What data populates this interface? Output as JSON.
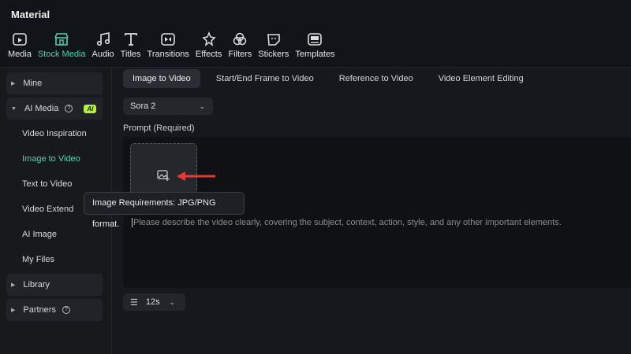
{
  "header": {
    "title": "Material"
  },
  "toolbar": [
    {
      "label": "Media",
      "icon": "media-icon"
    },
    {
      "label": "Stock Media",
      "icon": "stock-media-icon"
    },
    {
      "label": "Audio",
      "icon": "music-note-icon"
    },
    {
      "label": "Titles",
      "icon": "text-t-icon"
    },
    {
      "label": "Transitions",
      "icon": "transition-icon"
    },
    {
      "label": "Effects",
      "icon": "star-icon"
    },
    {
      "label": "Filters",
      "icon": "filter-icon"
    },
    {
      "label": "Stickers",
      "icon": "sticker-icon"
    },
    {
      "label": "Templates",
      "icon": "template-icon"
    }
  ],
  "sidebar": {
    "mine": "Mine",
    "ai_media": "AI Media",
    "ai_badge": "AI",
    "items": [
      "Video Inspiration",
      "Image to Video",
      "Text to Video",
      "Video Extend",
      "AI Image",
      "My Files"
    ],
    "library": "Library",
    "partners": "Partners"
  },
  "tabs": [
    "Image to Video",
    "Start/End Frame to Video",
    "Reference to Video",
    "Video Element Editing"
  ],
  "model": {
    "value": "Sora 2"
  },
  "prompt": {
    "label": "Prompt (Required)",
    "placeholder": "Please describe the video clearly, covering the subject, context, action, style, and any other important elements.",
    "tooltip": "Image Requirements: JPG/PNG format."
  },
  "duration": {
    "value": "12s"
  },
  "colors": {
    "accent": "#4fd1b0",
    "badge": "#b7f23a",
    "arrow": "#e53935"
  }
}
